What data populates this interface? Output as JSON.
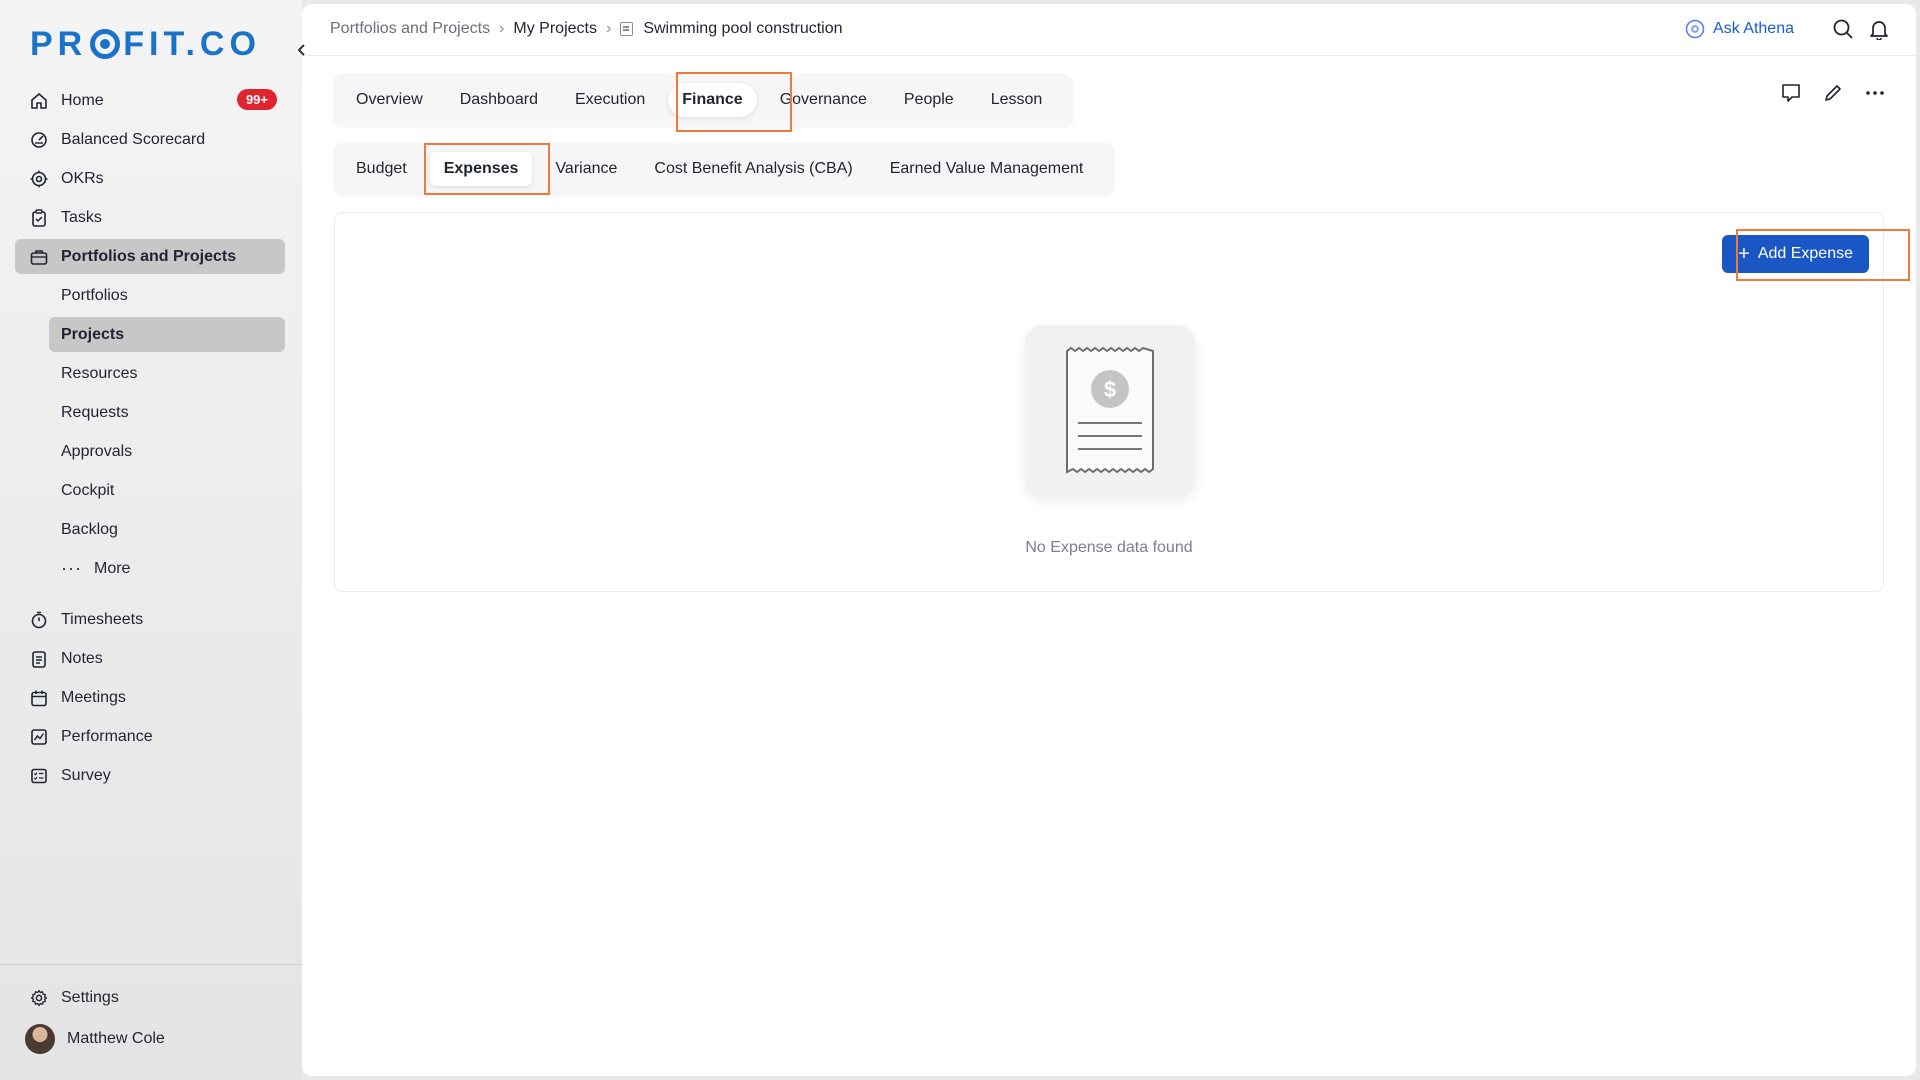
{
  "app": {
    "logo_text_left": "PR",
    "logo_text_right": "FIT.CO",
    "brand_color": "#1a72c9"
  },
  "sidebar": {
    "items": [
      {
        "label": "Home",
        "icon": "home-icon",
        "badge": "99+"
      },
      {
        "label": "Balanced Scorecard",
        "icon": "scorecard-icon"
      },
      {
        "label": "OKRs",
        "icon": "target-icon"
      },
      {
        "label": "Tasks",
        "icon": "clipboard-icon"
      },
      {
        "label": "Portfolios and Projects",
        "icon": "briefcase-icon",
        "active": true
      }
    ],
    "sub_items": [
      {
        "label": "Portfolios"
      },
      {
        "label": "Projects",
        "active": true
      },
      {
        "label": "Resources"
      },
      {
        "label": "Requests"
      },
      {
        "label": "Approvals"
      },
      {
        "label": "Cockpit"
      },
      {
        "label": "Backlog"
      },
      {
        "label": "More"
      }
    ],
    "items2": [
      {
        "label": "Timesheets",
        "icon": "stopwatch-icon"
      },
      {
        "label": "Notes",
        "icon": "notes-icon"
      },
      {
        "label": "Meetings",
        "icon": "calendar-icon"
      },
      {
        "label": "Performance",
        "icon": "chart-icon"
      },
      {
        "label": "Survey",
        "icon": "checklist-icon"
      }
    ],
    "settings_label": "Settings",
    "user_name": "Matthew Cole"
  },
  "topbar": {
    "breadcrumb": [
      "Portfolios and Projects",
      "My Projects",
      "Swimming pool construction"
    ],
    "ask_athena": "Ask Athena"
  },
  "tabs": [
    "Overview",
    "Dashboard",
    "Execution",
    "Finance",
    "Governance",
    "People",
    "Lesson"
  ],
  "active_tab": "Finance",
  "subtabs": [
    "Budget",
    "Expenses",
    "Variance",
    "Cost Benefit Analysis (CBA)",
    "Earned Value Management"
  ],
  "active_subtab": "Expenses",
  "panel": {
    "add_button_label": "Add Expense",
    "empty_message": "No Expense data found"
  },
  "colors": {
    "accent": "#1a56c4",
    "highlight": "#f07a3c",
    "badge": "#e0242f"
  }
}
